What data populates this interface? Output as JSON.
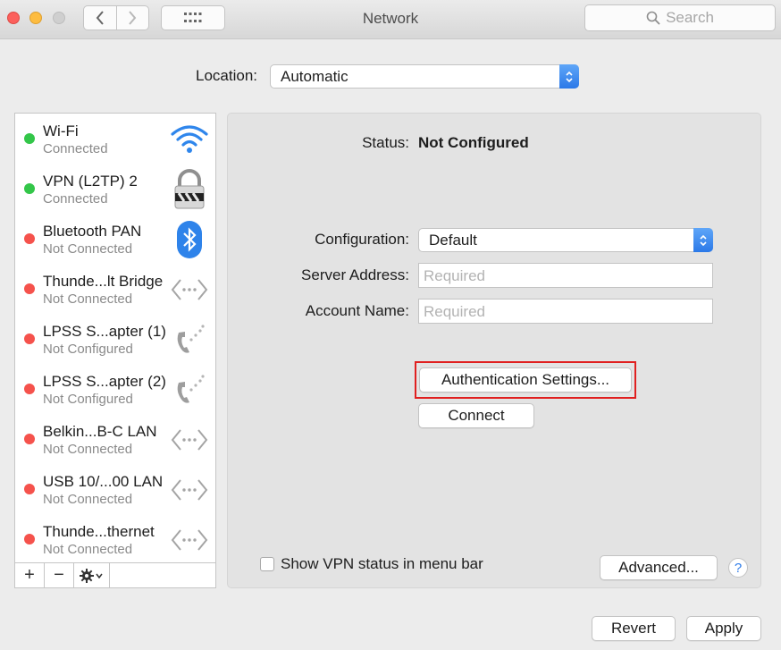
{
  "window": {
    "title": "Network",
    "search_placeholder": "Search"
  },
  "location": {
    "label": "Location:",
    "value": "Automatic"
  },
  "services": [
    {
      "name": "Wi-Fi",
      "status": "Connected",
      "status_color": "green",
      "icon": "wifi-icon"
    },
    {
      "name": "VPN (L2TP) 2",
      "status": "Connected",
      "status_color": "green",
      "icon": "vpn-lock-icon"
    },
    {
      "name": "Bluetooth PAN",
      "status": "Not Connected",
      "status_color": "red",
      "icon": "bluetooth-icon"
    },
    {
      "name": "Thunde...lt Bridge",
      "status": "Not Connected",
      "status_color": "red",
      "icon": "ethernet-arrows-icon"
    },
    {
      "name": "LPSS S...apter (1)",
      "status": "Not Configured",
      "status_color": "red",
      "icon": "phone-modem-icon"
    },
    {
      "name": "LPSS S...apter (2)",
      "status": "Not Configured",
      "status_color": "red",
      "icon": "phone-modem-icon"
    },
    {
      "name": "Belkin...B-C LAN",
      "status": "Not Connected",
      "status_color": "red",
      "icon": "ethernet-arrows-icon"
    },
    {
      "name": "USB 10/...00 LAN",
      "status": "Not Connected",
      "status_color": "red",
      "icon": "ethernet-arrows-icon"
    },
    {
      "name": "Thunde...thernet",
      "status": "Not Connected",
      "status_color": "red",
      "icon": "ethernet-arrows-icon"
    }
  ],
  "list_toolbar": {
    "add": "+",
    "remove": "−"
  },
  "detail": {
    "status_label": "Status:",
    "status_value": "Not Configured",
    "configuration_label": "Configuration:",
    "configuration_value": "Default",
    "server_label": "Server Address:",
    "server_placeholder": "Required",
    "account_label": "Account Name:",
    "account_placeholder": "Required",
    "auth_button": "Authentication Settings...",
    "connect_button": "Connect",
    "show_vpn_label": "Show VPN status in menu bar",
    "advanced_button": "Advanced...",
    "help": "?"
  },
  "footer": {
    "revert": "Revert",
    "apply": "Apply"
  },
  "colors": {
    "connected": "#33c649",
    "disconnected": "#f5524c",
    "accent": "#2b79e8",
    "highlight": "#e02020"
  }
}
